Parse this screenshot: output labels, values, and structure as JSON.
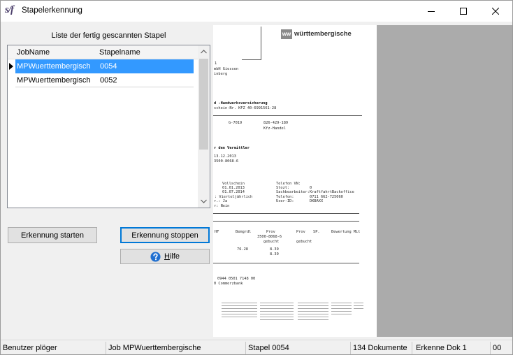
{
  "window": {
    "title": "Stapelerkennung",
    "logo_text": "s/f"
  },
  "icons": {
    "minimize": "minimize-icon",
    "maximize": "maximize-icon",
    "close": "close-icon",
    "row_pointer": "row-pointer-icon",
    "scroll_up": "chevron-up-icon",
    "scroll_down": "chevron-down-icon",
    "help": "help-icon"
  },
  "list": {
    "caption": "Liste der fertig gescannten Stapel",
    "columns": [
      "JobName",
      "Stapelname"
    ],
    "rows": [
      {
        "job": "MPWuerttembergisch",
        "stapel": "0054",
        "selected": true
      },
      {
        "job": "MPWuerttembergisch",
        "stapel": "0052",
        "selected": false
      }
    ]
  },
  "buttons": {
    "start": "Erkennung starten",
    "stop": "Erkennung stoppen",
    "help": "Hilfe"
  },
  "document": {
    "logo_mark": "ww",
    "logo_text": "württembergische",
    "lines": [
      "1",
      "mbH Giessen",
      "inberg",
      "d -Handwerksversicherung",
      "schein-Nr. KFZ 40-6991561-28",
      "G-7019",
      "826-429-189",
      "Kfz-Handel",
      "r den Vermittler",
      "13.12.2013",
      "3500-8068-6",
      "Vollschein",
      "Telefon VN:",
      "01.01.2013",
      "Stozt:",
      "0",
      "01.07.2014",
      "Sachbearbeiter:",
      "KraftfahrtBackoffice",
      ": Vierteljährlich",
      "Telefon:",
      "0711 662-725060",
      "r.: Ja",
      "User-ID:",
      "DKBAXX",
      "r: Nein",
      "HF",
      "Bemgrdl",
      "Prov",
      "Prov",
      "SP.",
      "Bewertung Mit",
      "3500-8068-6",
      "gebucht",
      "gebucht",
      "76.28",
      "8.39",
      "8.39",
      "0944 0501 7148 00",
      "0 Commerzbank"
    ]
  },
  "status_bar": [
    "Benutzer plöger",
    "Job MPWuerttembergische",
    "Stapel 0054",
    "134 Dokumente",
    "Erkenne Dok 1",
    "00"
  ],
  "colors": {
    "selection": "#3399ff",
    "focus_border": "#0078d7",
    "help_icon": "#1f6fd0"
  }
}
